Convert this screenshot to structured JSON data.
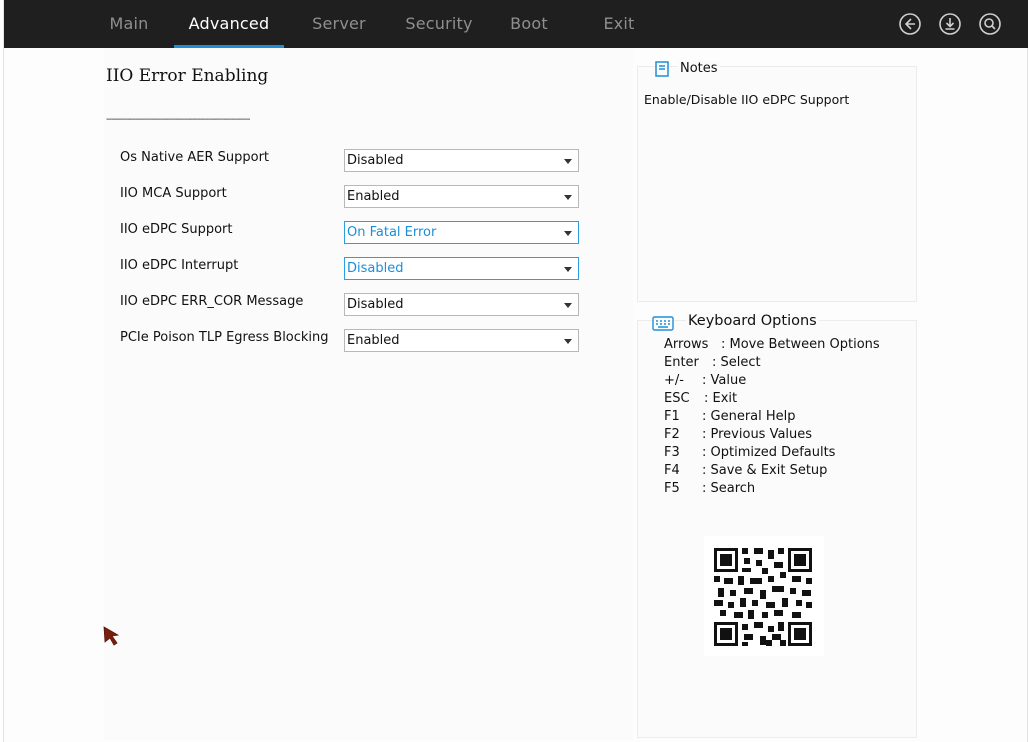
{
  "tabs": [
    {
      "label": "Main",
      "active": false
    },
    {
      "label": "Advanced",
      "active": true
    },
    {
      "label": "Server",
      "active": false
    },
    {
      "label": "Security",
      "active": false
    },
    {
      "label": "Boot",
      "active": false
    },
    {
      "label": "Exit",
      "active": false
    }
  ],
  "toolbar_icons": [
    "back-icon",
    "download-icon",
    "search-icon"
  ],
  "page": {
    "title": "IIO Error Enabling",
    "divider": "-------------------------------------------------------"
  },
  "settings": [
    {
      "label": "Os Native AER Support",
      "value": "Disabled",
      "focused": false
    },
    {
      "label": "IIO MCA Support",
      "value": "Enabled",
      "focused": false
    },
    {
      "label": "IIO eDPC Support",
      "value": "On Fatal Error",
      "focused": true
    },
    {
      "label": "IIO eDPC Interrupt",
      "value": "Disabled",
      "focused": true
    },
    {
      "label": "IIO eDPC ERR_COR Message",
      "value": "Disabled",
      "focused": false
    },
    {
      "label": "PCIe Poison TLP Egress Blocking",
      "value": "Enabled",
      "focused": false
    }
  ],
  "notes": {
    "title": "Notes",
    "text": "Enable/Disable IIO eDPC Support"
  },
  "keyboard": {
    "title": "Keyboard Options",
    "lines": [
      {
        "key": "Arrows",
        "desc": ": Move Between Options"
      },
      {
        "key": "Enter",
        "desc": ": Select"
      },
      {
        "key": "+/-",
        "desc": ": Value"
      },
      {
        "key": "ESC",
        "desc": ": Exit"
      },
      {
        "key": "F1",
        "desc": ": General Help"
      },
      {
        "key": "F2",
        "desc": ": Previous Values"
      },
      {
        "key": "F3",
        "desc": ": Optimized Defaults"
      },
      {
        "key": "F4",
        "desc": ": Save & Exit Setup"
      },
      {
        "key": "F5",
        "desc": ": Search"
      }
    ]
  },
  "colors": {
    "topbar": "#1f1f1f",
    "accent": "#1e8fd6",
    "tab_inactive": "#8f8f8f"
  }
}
